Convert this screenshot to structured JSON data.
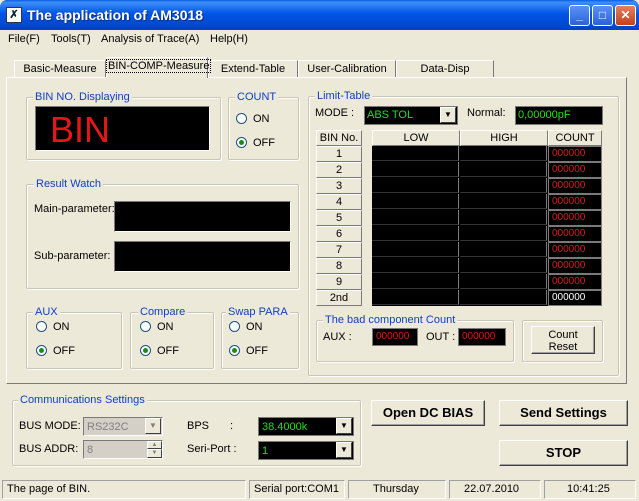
{
  "window": {
    "title": "The application of AM3018",
    "icon": "x-app-icon"
  },
  "menu": [
    "File(F)",
    "Tools(T)",
    "Analysis of Trace(A)",
    "Help(H)"
  ],
  "tabs": [
    "Basic-Measure",
    "BIN-COMP-Measure",
    "Extend-Table",
    "User-Calibration",
    "Data-Disp"
  ],
  "active_tab": "BIN-COMP-Measure",
  "bin_display": {
    "label": "BIN NO. Displaying",
    "value": "BIN"
  },
  "count": {
    "label": "COUNT",
    "on": "ON",
    "off": "OFF",
    "selected": "OFF"
  },
  "result_watch": {
    "label": "Result Watch",
    "main_label": "Main-parameter:",
    "sub_label": "Sub-parameter:"
  },
  "aux": {
    "label": "AUX",
    "on": "ON",
    "off": "OFF",
    "selected": "OFF"
  },
  "compare": {
    "label": "Compare",
    "on": "ON",
    "off": "OFF",
    "selected": "OFF"
  },
  "swap": {
    "label": "Swap PARA",
    "on": "ON",
    "off": "OFF",
    "selected": "OFF"
  },
  "limit_table": {
    "label": "Limit-Table",
    "mode_label": "MODE :",
    "mode_value": "ABS TOL",
    "normal_label": "Normal:",
    "normal_value": "0,00000pF",
    "headers": [
      "BIN No.",
      "LOW",
      "HIGH",
      "COUNT"
    ],
    "rows": [
      {
        "bin": "1",
        "count": "000000"
      },
      {
        "bin": "2",
        "count": "000000"
      },
      {
        "bin": "3",
        "count": "000000"
      },
      {
        "bin": "4",
        "count": "000000"
      },
      {
        "bin": "5",
        "count": "000000"
      },
      {
        "bin": "6",
        "count": "000000"
      },
      {
        "bin": "7",
        "count": "000000"
      },
      {
        "bin": "8",
        "count": "000000"
      },
      {
        "bin": "9",
        "count": "000000"
      },
      {
        "bin": "2nd",
        "count": "000000"
      }
    ]
  },
  "bad_count": {
    "label": "The bad component Count",
    "aux_label": "AUX :",
    "aux_value": "000000",
    "out_label": "OUT :",
    "out_value": "000000"
  },
  "count_reset": {
    "line1": "Count",
    "line2": "Reset"
  },
  "comm": {
    "label": "Communications Settings",
    "bus_mode_label": "BUS MODE:",
    "bus_mode_value": "RS232C",
    "bus_addr_label": "BUS ADDR:",
    "bus_addr_value": "8",
    "bps_label": "BPS",
    "bps_colon": ":",
    "bps_value": "38.4000k",
    "port_label": "Seri-Port :",
    "port_value": "1"
  },
  "buttons": {
    "open_dc": "Open DC BIAS",
    "send": "Send Settings",
    "stop": "STOP"
  },
  "status": [
    "The page of BIN.",
    "Serial port:COM1",
    "Thursday",
    "22.07.2010",
    "10:41:25"
  ],
  "colors": {
    "title_bar": "#0055e5",
    "group_label": "#1040c8",
    "led_red": "#e21818",
    "led_green": "#1fe01f"
  }
}
